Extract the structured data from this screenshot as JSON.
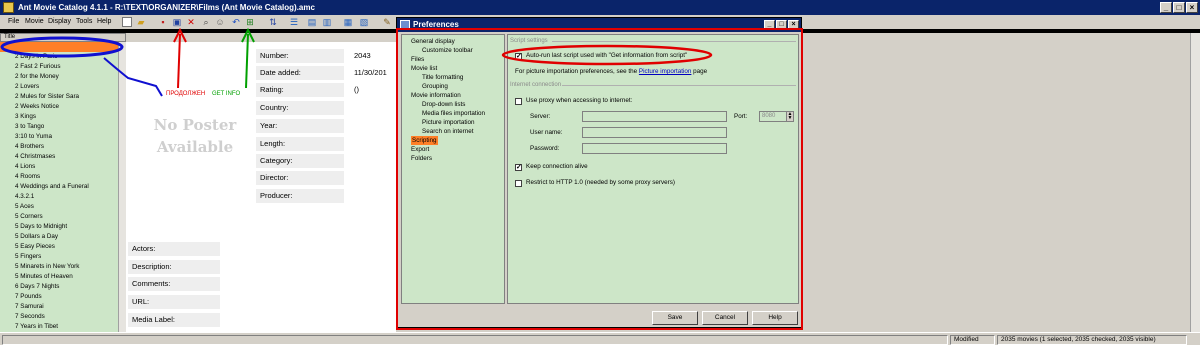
{
  "window": {
    "title": "Ant Movie Catalog 4.1.1 - R:\\TEXT\\ORGANIZER\\Films (Ant Movie Catalog).amc",
    "min": "_",
    "max": "□",
    "close": "×"
  },
  "menu": [
    "File",
    "Movie",
    "Display",
    "Tools",
    "Help"
  ],
  "list": {
    "header": "Title",
    "items": [
      "2 Days in Paris",
      "2 Fast 2 Furious",
      "2 for the Money",
      "2 Lovers",
      "2 Mules for Sister Sara",
      "2 Weeks Notice",
      "3 Kings",
      "3 to Tango",
      "3:10 to Yuma",
      "4 Brothers",
      "4 Christmases",
      "4 Lions",
      "4 Rooms",
      "4 Weddings and a Funeral",
      "4.3.2.1",
      "5 Aces",
      "5 Corners",
      "5 Days to Midnight",
      "5 Dollars a Day",
      "5 Easy Pieces",
      "5 Fingers",
      "5 Minarets in New York",
      "5 Minutes of Heaven",
      "6 Days 7 Nights",
      "7 Pounds",
      "7 Samurai",
      "7 Seconds",
      "7 Years in Tibet"
    ]
  },
  "detail": {
    "no_poster_line1": "No Poster",
    "no_poster_line2": "Available",
    "fields": {
      "number_label": "Number:",
      "number_value": "2043",
      "date_label": "Date added:",
      "date_value": "11/30/201",
      "rating_label": "Rating:",
      "rating_value": "()",
      "country_label": "Country:",
      "year_label": "Year:",
      "length_label": "Length:",
      "category_label": "Category:",
      "director_label": "Director:",
      "producer_label": "Producer:",
      "actors_label": "Actors:",
      "description_label": "Description:",
      "comments_label": "Comments:",
      "url_label": "URL:",
      "media_label": "Media Label:"
    }
  },
  "annotations": {
    "red": "ПРОДОЛЖЕН",
    "green": "GET INFO"
  },
  "dialog": {
    "title": "Preferences",
    "tree": [
      {
        "label": "General display",
        "level": 0
      },
      {
        "label": "Customize toolbar",
        "level": 1
      },
      {
        "label": "Files",
        "level": 0
      },
      {
        "label": "Movie list",
        "level": 0
      },
      {
        "label": "Title formatting",
        "level": 1
      },
      {
        "label": "Grouping",
        "level": 1
      },
      {
        "label": "Movie information",
        "level": 0
      },
      {
        "label": "Drop-down lists",
        "level": 1
      },
      {
        "label": "Media files importation",
        "level": 1
      },
      {
        "label": "Picture importation",
        "level": 1
      },
      {
        "label": "Search on internet",
        "level": 1
      },
      {
        "label": "Scripting",
        "level": 0,
        "selected": true
      },
      {
        "label": "Export",
        "level": 0
      },
      {
        "label": "Folders",
        "level": 0
      }
    ],
    "script_settings": {
      "heading": "Script settings",
      "autorun_label": "Auto-run last script used with \"Get information from script\"",
      "autorun_checked": true,
      "picture_note_prefix": "For picture importation preferences, see the",
      "picture_note_link": "Picture importation",
      "picture_note_suffix": "page"
    },
    "internet": {
      "heading": "Internet connection",
      "proxy_label": "Use proxy when accessing to internet:",
      "proxy_checked": false,
      "server_label": "Server:",
      "port_label": "Port:",
      "port_value": "8080",
      "username_label": "User name:",
      "password_label": "Password:",
      "keepalive_label": "Keep connection alive",
      "keepalive_checked": true,
      "http10_label": "Restrict to HTTP 1.0 (needed by some proxy servers)",
      "http10_checked": false
    },
    "buttons": {
      "save": "Save",
      "cancel": "Cancel",
      "help": "Help"
    }
  },
  "status": {
    "modified": "Modified",
    "counts": "2035 movies (1 selected, 2035 checked, 2035 visible)"
  },
  "colors": {
    "titlebar": "#0a246a",
    "list_bg": "#cde6c8",
    "selection": "#ff7f27",
    "annot_red": "#e00000",
    "annot_green": "#00a000",
    "annot_blue": "#1010d0"
  }
}
